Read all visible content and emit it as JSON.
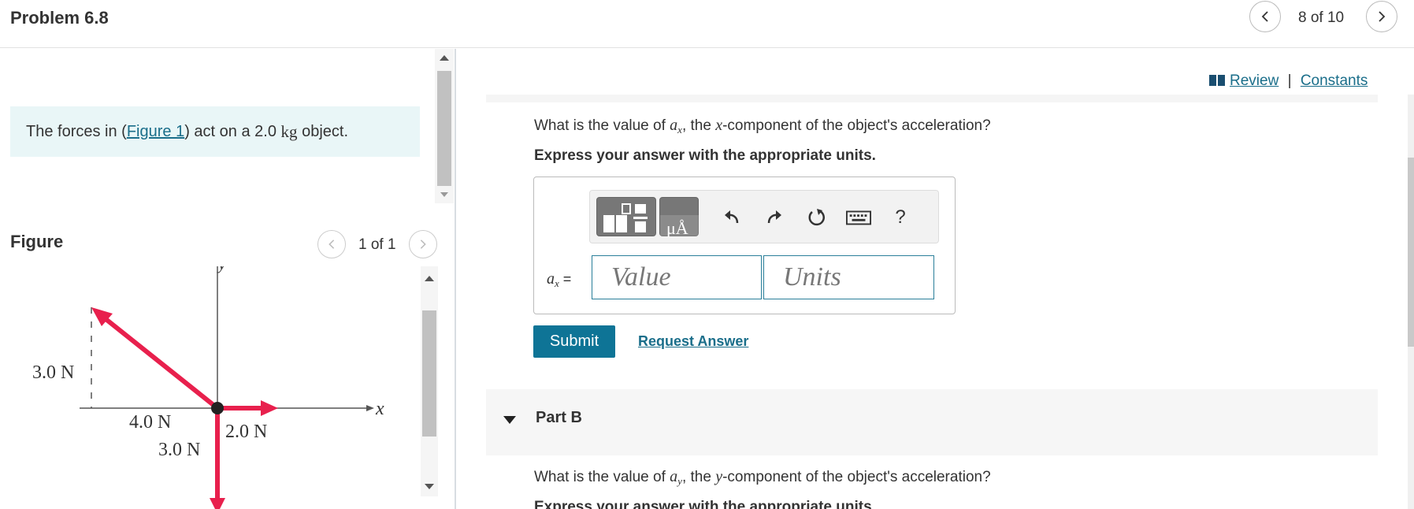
{
  "header": {
    "title": "Problem 6.8",
    "position": "8 of 10"
  },
  "intro": {
    "prefix": "The forces in (",
    "link": "Figure 1",
    "suffix": ") act on a 2.0",
    "unit": "kg",
    "tail": "object."
  },
  "figure": {
    "label": "Figure",
    "position": "1 of 1",
    "axis_x": "x",
    "axis_y": "y",
    "force_labels": [
      "3.0 N",
      "4.0 N",
      "2.0 N",
      "3.0 N"
    ],
    "arrow_color": "#e8204d"
  },
  "links": {
    "review": "Review",
    "separator": "|",
    "constants": "Constants"
  },
  "part_a": {
    "question_prefix": "What is the value of",
    "question_var": "a",
    "question_sub": "x",
    "question_mid": ", the",
    "question_comp": "x",
    "question_suffix": "-component of the object's acceleration?",
    "express": "Express your answer with the appropriate units.",
    "var_label": "a",
    "var_sub": "x",
    "equals": "=",
    "value_placeholder": "Value",
    "units_placeholder": "Units",
    "help": "?",
    "units_icon_text": "μÅ"
  },
  "actions": {
    "submit": "Submit",
    "request": "Request Answer"
  },
  "part_b": {
    "label": "Part B",
    "question_prefix": "What is the value of",
    "question_var": "a",
    "question_sub": "y",
    "question_mid": ", the",
    "question_comp": "y",
    "question_suffix": "-component of the object's acceleration?",
    "express": "Express your answer with the appropriate units."
  },
  "colors": {
    "accent": "#0e7496",
    "link": "#1a6e8a",
    "intro_bg": "#e9f6f7"
  }
}
